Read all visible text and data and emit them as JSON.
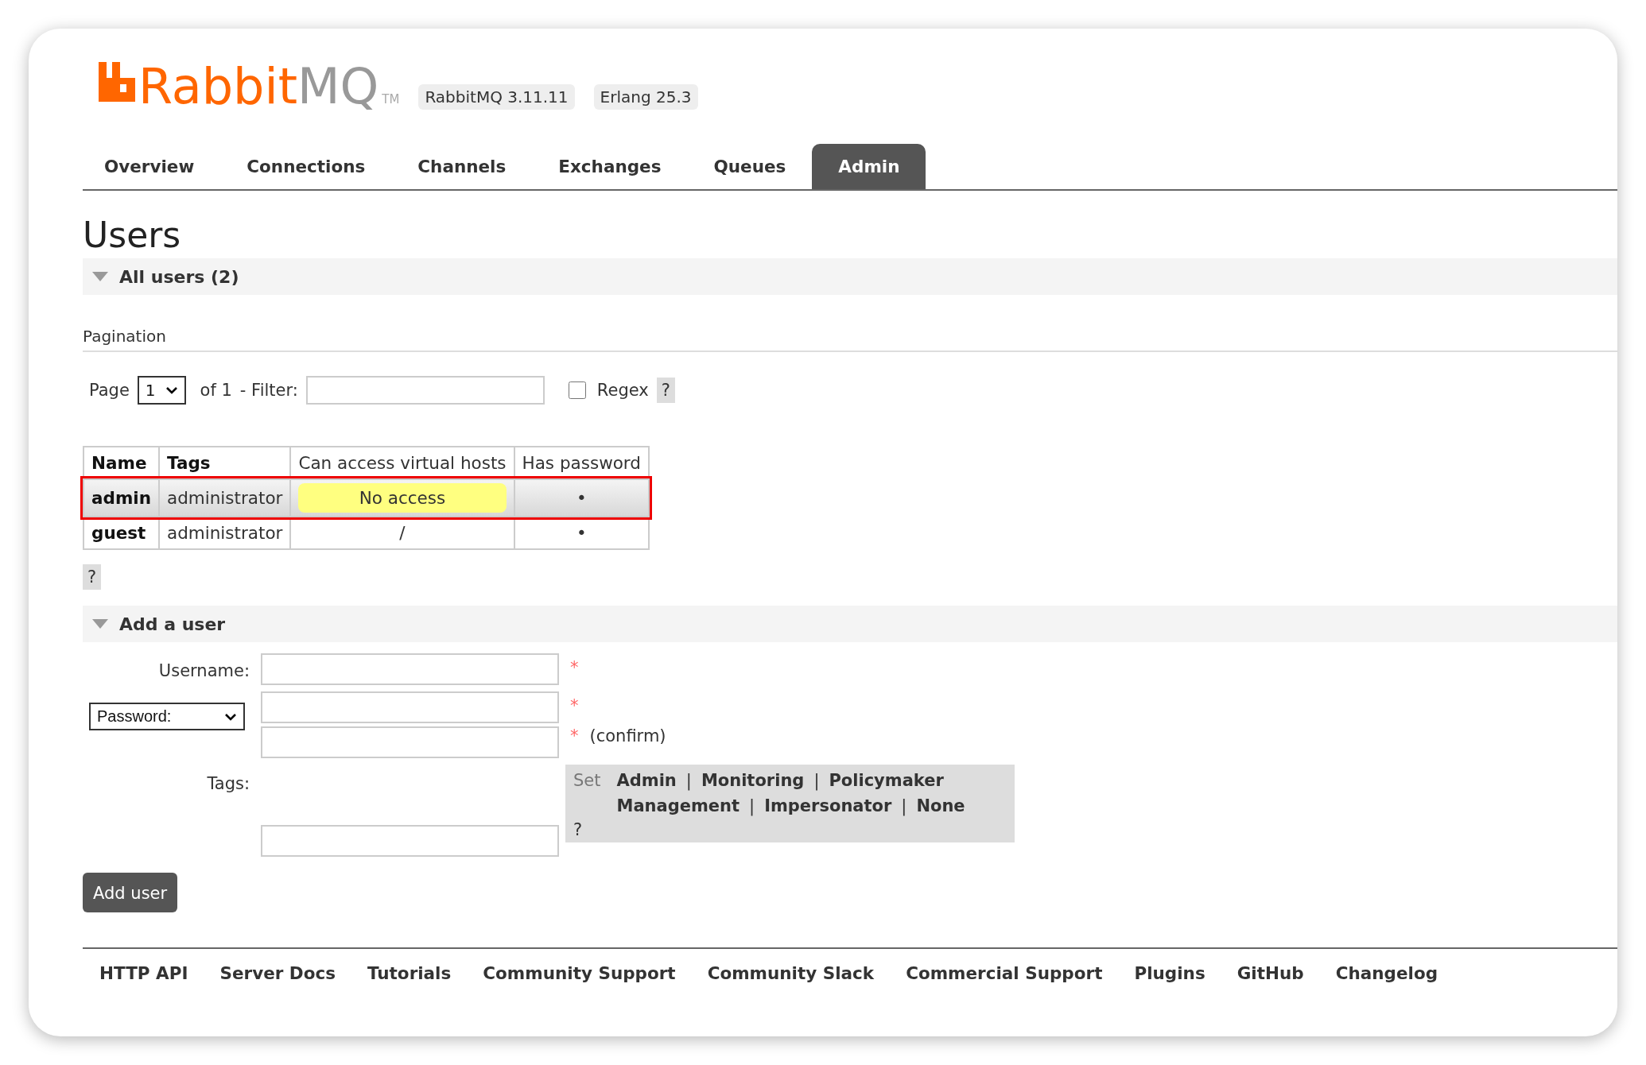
{
  "header": {
    "logo": {
      "brand": "Rabbit",
      "suffix": "MQ",
      "trademark": "TM"
    },
    "badges": [
      "RabbitMQ 3.11.11",
      "Erlang 25.3"
    ]
  },
  "tabs": [
    {
      "label": "Overview",
      "selected": false
    },
    {
      "label": "Connections",
      "selected": false
    },
    {
      "label": "Channels",
      "selected": false
    },
    {
      "label": "Exchanges",
      "selected": false
    },
    {
      "label": "Queues",
      "selected": false
    },
    {
      "label": "Admin",
      "selected": true
    }
  ],
  "page_title": "Users",
  "all_users": {
    "heading": "All users (2)",
    "expanded": true,
    "pagination": {
      "title": "Pagination",
      "page_label": "Page",
      "page_value": "1",
      "of_label": "of 1",
      "filter_label": "- Filter:",
      "regex_label": "Regex",
      "regex_checked": false,
      "help": "?"
    },
    "table": {
      "columns": [
        "Name",
        "Tags",
        "Can access virtual hosts",
        "Has password"
      ],
      "rows": [
        {
          "name": "admin",
          "tags": "administrator",
          "vhosts": {
            "kind": "badge",
            "text": "No access"
          },
          "has_password": "•",
          "highlighted": true
        },
        {
          "name": "guest",
          "tags": "administrator",
          "vhosts": {
            "kind": "plain",
            "text": "/"
          },
          "has_password": "•",
          "highlighted": false
        }
      ]
    },
    "help": "?"
  },
  "add_user": {
    "heading": "Add a user",
    "expanded": true,
    "username": {
      "label": "Username:",
      "mark": "*"
    },
    "password": {
      "mode": "Password:",
      "mark": "*"
    },
    "confirm": {
      "mark": "*",
      "note": "(confirm)"
    },
    "tags": {
      "label": "Tags:",
      "set_label": "Set",
      "options": [
        "Admin",
        "Monitoring",
        "Policymaker",
        "Management",
        "Impersonator",
        "None"
      ],
      "separator": "|",
      "help": "?"
    },
    "submit": "Add user"
  },
  "footer_links": [
    "HTTP API",
    "Server Docs",
    "Tutorials",
    "Community Support",
    "Community Slack",
    "Commercial Support",
    "Plugins",
    "GitHub",
    "Changelog"
  ]
}
